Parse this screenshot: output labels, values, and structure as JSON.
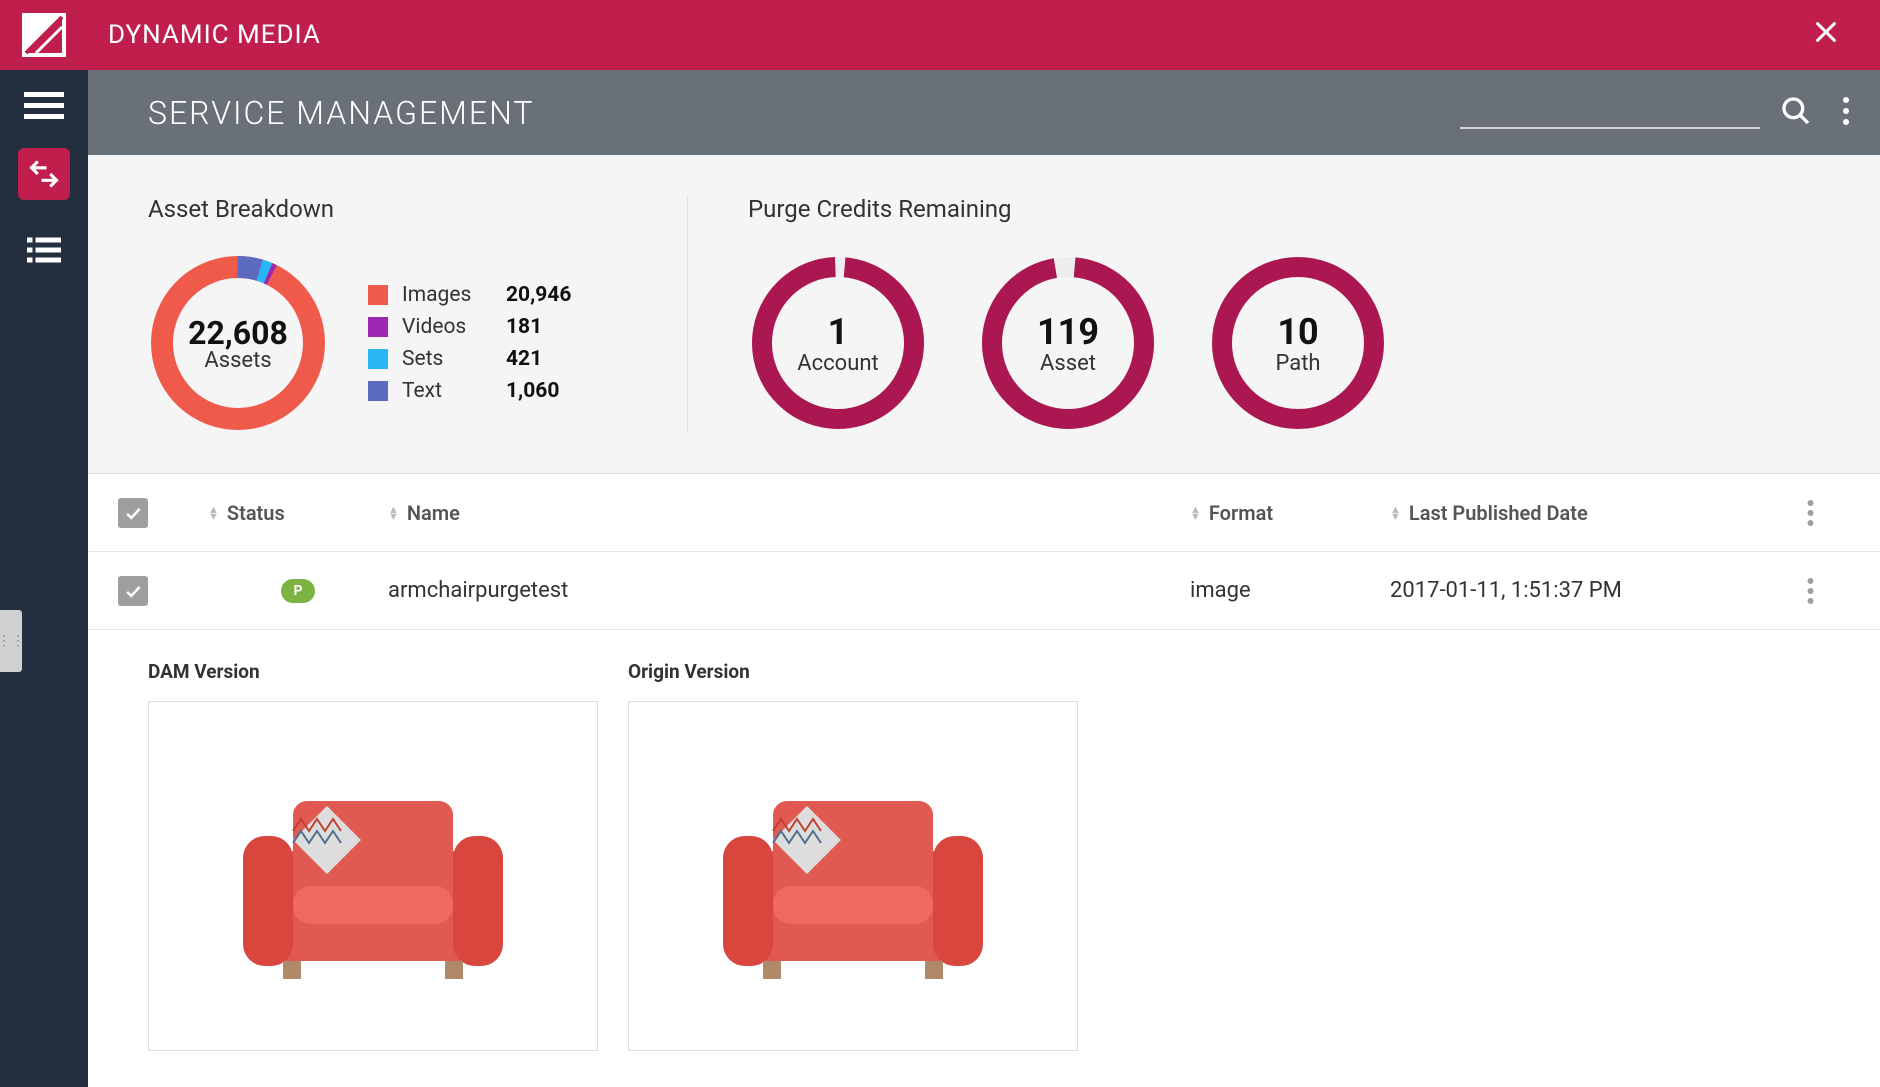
{
  "topbar": {
    "app_title": "DYNAMIC MEDIA"
  },
  "subheader": {
    "page_title": "SERVICE MANAGEMENT"
  },
  "breakdown": {
    "title": "Asset Breakdown",
    "total_value": "22,608",
    "total_label": "Assets",
    "legend": [
      {
        "label": "Images",
        "value": "20,946",
        "color": "#ef5a4a"
      },
      {
        "label": "Videos",
        "value": "181",
        "color": "#9c27b0"
      },
      {
        "label": "Sets",
        "value": "421",
        "color": "#29b6f6"
      },
      {
        "label": "Text",
        "value": "1,060",
        "color": "#5c6bc0"
      }
    ]
  },
  "purge": {
    "title": "Purge Credits Remaining",
    "gauges": [
      {
        "value": "1",
        "label": "Account",
        "pct": 98
      },
      {
        "value": "119",
        "label": "Asset",
        "pct": 96
      },
      {
        "value": "10",
        "label": "Path",
        "pct": 100
      }
    ]
  },
  "table": {
    "columns": {
      "status": "Status",
      "name": "Name",
      "format": "Format",
      "published": "Last Published Date"
    },
    "rows": [
      {
        "status": "P",
        "name": "armchairpurgetest",
        "format": "image",
        "published": "2017-01-11, 1:51:37 PM"
      }
    ]
  },
  "versions": {
    "dam_label": "DAM Version",
    "origin_label": "Origin Version"
  },
  "chart_data": [
    {
      "type": "pie",
      "title": "Asset Breakdown",
      "categories": [
        "Images",
        "Videos",
        "Sets",
        "Text"
      ],
      "values": [
        20946,
        181,
        421,
        1060
      ],
      "total": 22608
    },
    {
      "type": "bar",
      "title": "Purge Credits Remaining",
      "categories": [
        "Account",
        "Asset",
        "Path"
      ],
      "values": [
        1,
        119,
        10
      ]
    }
  ]
}
